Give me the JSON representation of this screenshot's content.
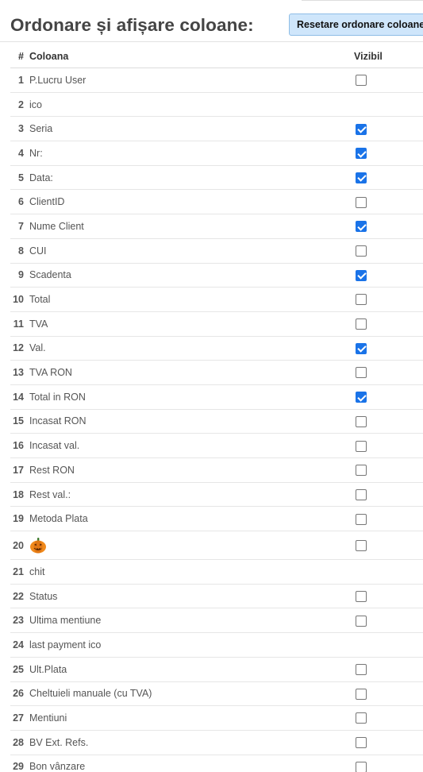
{
  "title": "Ordonare și afișare coloane:",
  "reset_button_label": "Resetare ordonare coloane",
  "table": {
    "headers": {
      "num": "#",
      "name": "Coloana",
      "visible": "Vizibil"
    },
    "rows": [
      {
        "num": "1",
        "name": "P.Lucru User",
        "visible": false,
        "has_checkbox": true
      },
      {
        "num": "2",
        "name": "ico",
        "visible": false,
        "has_checkbox": false
      },
      {
        "num": "3",
        "name": "Seria",
        "visible": true,
        "has_checkbox": true
      },
      {
        "num": "4",
        "name": "Nr:",
        "visible": true,
        "has_checkbox": true
      },
      {
        "num": "5",
        "name": "Data:",
        "visible": true,
        "has_checkbox": true
      },
      {
        "num": "6",
        "name": "ClientID",
        "visible": false,
        "has_checkbox": true
      },
      {
        "num": "7",
        "name": "Nume Client",
        "visible": true,
        "has_checkbox": true
      },
      {
        "num": "8",
        "name": "CUI",
        "visible": false,
        "has_checkbox": true
      },
      {
        "num": "9",
        "name": "Scadenta",
        "visible": true,
        "has_checkbox": true
      },
      {
        "num": "10",
        "name": "Total",
        "visible": false,
        "has_checkbox": true
      },
      {
        "num": "11",
        "name": "TVA",
        "visible": false,
        "has_checkbox": true
      },
      {
        "num": "12",
        "name": "Val.",
        "visible": true,
        "has_checkbox": true
      },
      {
        "num": "13",
        "name": "TVA  RON",
        "visible": false,
        "has_checkbox": true
      },
      {
        "num": "14",
        "name": "Total in RON",
        "visible": true,
        "has_checkbox": true
      },
      {
        "num": "15",
        "name": "Incasat RON",
        "visible": false,
        "has_checkbox": true
      },
      {
        "num": "16",
        "name": "Incasat val.",
        "visible": false,
        "has_checkbox": true
      },
      {
        "num": "17",
        "name": "Rest RON",
        "visible": false,
        "has_checkbox": true
      },
      {
        "num": "18",
        "name": "Rest val.:",
        "visible": false,
        "has_checkbox": true
      },
      {
        "num": "19",
        "name": "Metoda Plata",
        "visible": false,
        "has_checkbox": true
      },
      {
        "num": "20",
        "name": "",
        "icon": "pumpkin-icon",
        "visible": false,
        "has_checkbox": true
      },
      {
        "num": "21",
        "name": "chit",
        "visible": false,
        "has_checkbox": false
      },
      {
        "num": "22",
        "name": "Status",
        "visible": false,
        "has_checkbox": true
      },
      {
        "num": "23",
        "name": "Ultima mentiune",
        "visible": false,
        "has_checkbox": true
      },
      {
        "num": "24",
        "name": "last payment ico",
        "visible": false,
        "has_checkbox": false
      },
      {
        "num": "25",
        "name": "Ult.Plata",
        "visible": false,
        "has_checkbox": true
      },
      {
        "num": "26",
        "name": "Cheltuieli manuale (cu TVA)",
        "visible": false,
        "has_checkbox": true
      },
      {
        "num": "27",
        "name": "Mentiuni",
        "visible": false,
        "has_checkbox": true
      },
      {
        "num": "28",
        "name": "BV Ext. Refs.",
        "visible": false,
        "has_checkbox": true
      },
      {
        "num": "29",
        "name": "Bon vânzare",
        "visible": false,
        "has_checkbox": true
      }
    ]
  },
  "colors": {
    "checkbox_checked": "#1a73e8",
    "button_bg": "#cfe6fb",
    "button_border": "#8fbde6"
  }
}
